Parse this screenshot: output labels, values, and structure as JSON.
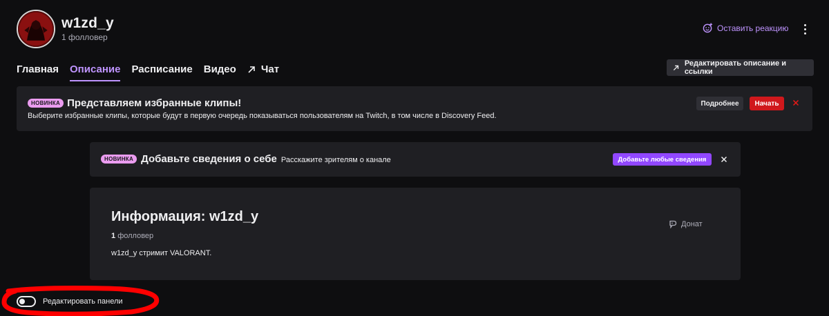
{
  "channel": {
    "name": "w1zd_y",
    "followers": "1 фоллловер"
  },
  "header": {
    "react_label": "Оставить реакцию",
    "more_icon": "more-vertical-icon"
  },
  "tabs": [
    {
      "label": "Главная",
      "active": false
    },
    {
      "label": "Описание",
      "active": true
    },
    {
      "label": "Расписание",
      "active": false
    },
    {
      "label": "Видео",
      "active": false
    },
    {
      "label": "Чат",
      "active": false,
      "icon": "external-arrow-icon"
    }
  ],
  "edit_description_label": "Редактировать описание и ссылки",
  "promo": {
    "badge": "НОВИНКА",
    "title": "Представляем избранные клипы!",
    "description": "Выберите избранные клипы, которые будут в первую очередь показываться пользователям на Twitch, в том числе в Discovery Feed.",
    "more_label": "Подробнее",
    "start_label": "Начать"
  },
  "about_prompt": {
    "badge": "НОВИНКА",
    "title": "Добавьте сведения о себе",
    "subtitle": "Расскажите зрителям о канале",
    "button_label": "Добавьте любые сведения"
  },
  "info": {
    "title": "Информация: w1zd_y",
    "followers_count": "1",
    "followers_word": "фолловер",
    "description": "w1zd_y стримит VALORANT.",
    "donate_label": "Донат"
  },
  "edit_panels_label": "Редактировать панели",
  "colors": {
    "background": "#0e0e10",
    "surface": "#1f1f23",
    "accent": "#bf94ff",
    "primary_button": "#9147ff",
    "danger": "#d0181c",
    "badge": "#eb9cf0",
    "highlight": "#ff0000"
  }
}
